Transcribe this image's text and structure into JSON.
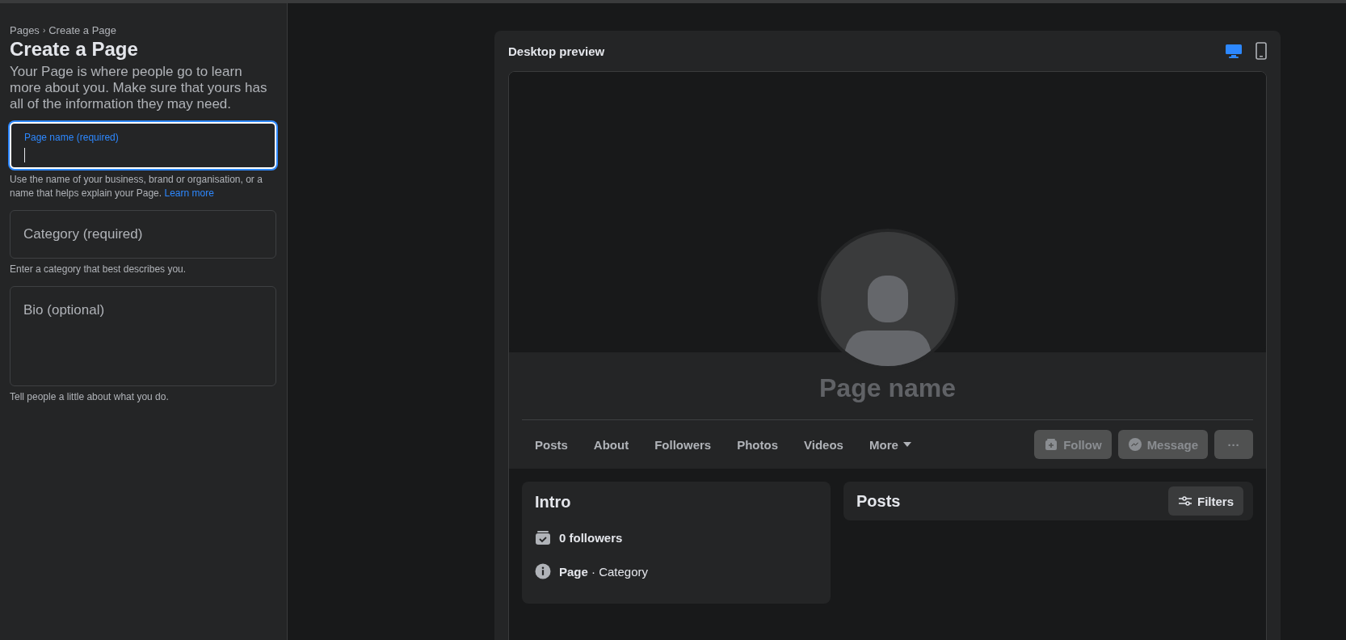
{
  "breadcrumb": {
    "items": [
      "Pages",
      "Create a Page"
    ],
    "separator": "›"
  },
  "title": "Create a Page",
  "description": "Your Page is where people go to learn more about you. Make sure that yours has all of the information they may need.",
  "fields": [
    {
      "kind": "input",
      "label": "Page name (required)",
      "focused": true,
      "help": "Use the name of your business, brand or organisation, or a name that helps explain your Page.",
      "help_link": "Learn more"
    },
    {
      "kind": "input",
      "placeholder": "Category (required)",
      "focused": false,
      "help": "Enter a category that best describes you."
    },
    {
      "kind": "textarea",
      "placeholder": "Bio (optional)",
      "focused": false,
      "help": "Tell people a little about what you do."
    }
  ],
  "preview": {
    "title": "Desktop preview",
    "devices": [
      {
        "kind": "desktop",
        "selected": true
      },
      {
        "kind": "mobile",
        "selected": false
      }
    ],
    "page_name": "Page name",
    "tabs": [
      {
        "label": "Posts"
      },
      {
        "label": "About"
      },
      {
        "label": "Followers"
      },
      {
        "label": "Photos"
      },
      {
        "label": "Videos"
      },
      {
        "label": "More",
        "dropdown": true
      }
    ],
    "actions": [
      {
        "kind": "follow",
        "label": "Follow",
        "disabled": true
      },
      {
        "kind": "message",
        "label": "Message",
        "disabled": true
      },
      {
        "kind": "more",
        "label": "···",
        "disabled": true
      }
    ],
    "intro": {
      "title": "Intro",
      "items": [
        {
          "kind": "followers",
          "text": "**0 followers**"
        },
        {
          "kind": "info",
          "text": "**Page** · Category"
        }
      ]
    },
    "posts": {
      "title": "Posts",
      "filter_button": "Filters"
    }
  }
}
